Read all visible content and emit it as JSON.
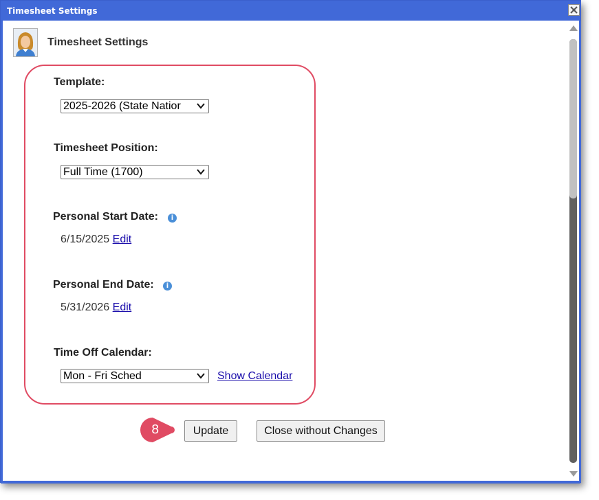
{
  "window": {
    "title": "Timesheet Settings"
  },
  "header": {
    "title": "Timesheet Settings",
    "avatar_icon": "user-avatar-icon"
  },
  "form": {
    "template": {
      "label": "Template:",
      "value": "2025-2026 (State Natior"
    },
    "position": {
      "label": "Timesheet Position:",
      "value": "Full Time (1700)"
    },
    "start_date": {
      "label": "Personal Start Date:",
      "value": "6/15/2025",
      "edit": "Edit",
      "info": "i"
    },
    "end_date": {
      "label": "Personal End Date:",
      "value": "5/31/2026",
      "edit": "Edit",
      "info": "i"
    },
    "calendar": {
      "label": "Time Off Calendar:",
      "value": "Mon - Fri Sched",
      "link": "Show Calendar"
    }
  },
  "actions": {
    "update": "Update",
    "close": "Close without Changes"
  },
  "callout": {
    "number": "8",
    "color": "#e04b63"
  },
  "colors": {
    "titlebar": "#4169d8",
    "highlight": "#e04b63",
    "link": "#1a0dab"
  }
}
